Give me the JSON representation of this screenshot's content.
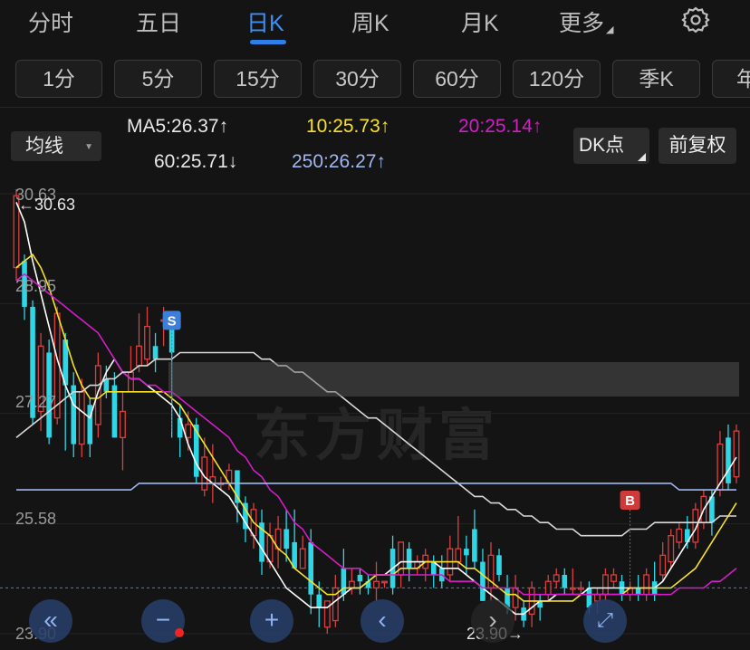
{
  "period_tabs": [
    {
      "label": "分时",
      "active": false
    },
    {
      "label": "五日",
      "active": false
    },
    {
      "label": "日K",
      "active": true
    },
    {
      "label": "周K",
      "active": false
    },
    {
      "label": "月K",
      "active": false
    },
    {
      "label": "更多",
      "active": false
    }
  ],
  "interval_buttons": [
    "1分",
    "5分",
    "15分",
    "30分",
    "60分",
    "120分",
    "季K",
    "年"
  ],
  "indicator": {
    "select_label": "均线",
    "ma5": "MA5:26.37↑",
    "ma10": "10:25.73↑",
    "ma20": "20:25.14↑",
    "ma60": "60:25.71↓",
    "ma250": "250:26.27↑",
    "dk_label": "DK点",
    "adjust_label": "前复权"
  },
  "chart_data": {
    "type": "candlestick",
    "y_axis_labels": [
      "30.63",
      "28.95",
      "27.27",
      "25.58",
      "23.90"
    ],
    "ylim": [
      23.9,
      30.63
    ],
    "high_marker": "←30.63",
    "low_marker": "23.90→",
    "signals": [
      {
        "label": "S",
        "color": "#3b7fd9"
      },
      {
        "label": "B",
        "color": "#d03a3a"
      }
    ],
    "watermark": "东方财富",
    "candles": [
      [
        29.5,
        30.6,
        30.7,
        29.3
      ],
      [
        29.6,
        28.9,
        29.7,
        28.7
      ],
      [
        28.9,
        27.2,
        29.0,
        27.1
      ],
      [
        27.3,
        28.3,
        28.5,
        27.0
      ],
      [
        28.2,
        26.9,
        28.4,
        26.8
      ],
      [
        27.2,
        28.8,
        28.9,
        27.1
      ],
      [
        28.4,
        27.7,
        28.5,
        26.7
      ],
      [
        27.7,
        26.8,
        27.9,
        26.6
      ],
      [
        26.8,
        27.6,
        27.8,
        26.6
      ],
      [
        27.4,
        26.8,
        27.5,
        26.6
      ],
      [
        27.1,
        28.0,
        28.2,
        26.9
      ],
      [
        27.8,
        27.6,
        28.0,
        27.5
      ],
      [
        27.7,
        26.9,
        27.9,
        26.9
      ],
      [
        26.9,
        27.3,
        27.6,
        26.4
      ],
      [
        27.6,
        27.9,
        28.3,
        27.6
      ],
      [
        28.0,
        28.3,
        28.8,
        27.9
      ],
      [
        28.1,
        28.6,
        28.9,
        28.0
      ],
      [
        28.3,
        28.1,
        28.5,
        27.9
      ],
      [
        28.7,
        28.7,
        28.9,
        28.3
      ],
      [
        28.6,
        28.2,
        28.8,
        26.9
      ],
      [
        27.2,
        26.9,
        27.4,
        26.6
      ],
      [
        26.9,
        27.1,
        27.3,
        26.7
      ],
      [
        27.1,
        26.3,
        27.2,
        26.2
      ],
      [
        26.1,
        26.6,
        26.9,
        26.0
      ],
      [
        26.2,
        26.3,
        26.8,
        25.9
      ],
      [
        26.2,
        26.2,
        26.3,
        26.1
      ],
      [
        26.2,
        26.4,
        26.5,
        26.1
      ],
      [
        26.4,
        25.9,
        26.4,
        25.6
      ],
      [
        25.9,
        25.5,
        26.0,
        25.3
      ],
      [
        25.4,
        25.8,
        25.9,
        25.2
      ],
      [
        25.6,
        25.0,
        25.8,
        24.8
      ],
      [
        25.0,
        25.4,
        25.6,
        24.9
      ],
      [
        25.2,
        25.5,
        25.7,
        24.9
      ],
      [
        25.5,
        25.2,
        25.8,
        25.0
      ],
      [
        25.3,
        24.9,
        25.8,
        24.9
      ],
      [
        24.9,
        25.2,
        25.4,
        24.9
      ],
      [
        25.3,
        24.5,
        25.5,
        24.2
      ],
      [
        24.5,
        24.3,
        24.7,
        24.0
      ],
      [
        24.0,
        24.4,
        24.4,
        23.9
      ],
      [
        24.1,
        24.6,
        24.8,
        24.0
      ],
      [
        24.9,
        24.5,
        25.2,
        24.4
      ],
      [
        24.6,
        24.7,
        24.9,
        24.5
      ],
      [
        24.8,
        24.7,
        24.9,
        24.5
      ],
      [
        24.7,
        24.6,
        24.8,
        24.5
      ],
      [
        24.6,
        24.7,
        25.0,
        24.4
      ],
      [
        24.7,
        24.7,
        24.7,
        24.6
      ],
      [
        25.2,
        24.6,
        25.4,
        24.5
      ],
      [
        24.8,
        25.3,
        25.3,
        24.6
      ],
      [
        25.2,
        24.9,
        25.3,
        24.7
      ],
      [
        24.9,
        25.0,
        25.1,
        24.8
      ],
      [
        24.9,
        25.1,
        25.2,
        24.7
      ],
      [
        25.0,
        24.8,
        25.1,
        24.6
      ],
      [
        24.9,
        24.7,
        25.1,
        24.6
      ],
      [
        24.8,
        25.2,
        25.4,
        24.7
      ],
      [
        25.0,
        25.2,
        25.7,
        24.9
      ],
      [
        25.2,
        25.1,
        25.4,
        24.8
      ],
      [
        25.5,
        25.0,
        25.8,
        24.9
      ],
      [
        25.0,
        24.4,
        25.2,
        24.4
      ],
      [
        24.6,
        25.1,
        25.3,
        24.4
      ],
      [
        25.1,
        24.8,
        25.2,
        24.7
      ],
      [
        24.6,
        24.3,
        24.8,
        24.2
      ],
      [
        24.3,
        24.6,
        24.8,
        24.1
      ],
      [
        24.3,
        24.1,
        24.4,
        24.0
      ],
      [
        24.2,
        24.6,
        24.7,
        24.0
      ],
      [
        24.4,
        24.3,
        24.5,
        24.1
      ],
      [
        24.5,
        24.7,
        24.8,
        24.4
      ],
      [
        24.7,
        24.8,
        24.9,
        24.6
      ],
      [
        24.8,
        24.6,
        24.9,
        24.5
      ],
      [
        24.6,
        24.6,
        24.9,
        24.5
      ],
      [
        24.6,
        24.6,
        24.7,
        24.5
      ],
      [
        24.6,
        24.3,
        24.7,
        24.2
      ],
      [
        24.4,
        24.5,
        24.6,
        24.2
      ],
      [
        24.5,
        24.8,
        24.9,
        24.4
      ],
      [
        24.7,
        24.8,
        24.9,
        24.6
      ],
      [
        24.7,
        24.5,
        24.8,
        24.4
      ],
      [
        24.5,
        24.6,
        24.7,
        24.4
      ],
      [
        24.6,
        24.5,
        24.8,
        24.4
      ],
      [
        24.5,
        24.8,
        24.9,
        24.4
      ],
      [
        24.7,
        24.5,
        25.0,
        24.4
      ],
      [
        24.8,
        25.1,
        25.3,
        24.7
      ],
      [
        25.0,
        25.4,
        25.5,
        24.9
      ],
      [
        25.3,
        25.5,
        25.6,
        25.2
      ],
      [
        25.5,
        25.3,
        25.7,
        25.2
      ],
      [
        25.3,
        25.8,
        25.9,
        25.2
      ],
      [
        25.6,
        26.0,
        26.1,
        25.5
      ],
      [
        26.0,
        25.6,
        26.1,
        25.4
      ],
      [
        26.1,
        26.8,
        27.0,
        26.0
      ],
      [
        26.9,
        26.2,
        27.1,
        26.1
      ],
      [
        26.3,
        27.0,
        27.1,
        26.2
      ]
    ],
    "ma_series": [
      {
        "name": "MA5",
        "color": "#ffffff",
        "values": [
          30.5,
          30.2,
          29.6,
          29.1,
          28.6,
          28.1,
          27.7,
          27.4,
          27.3,
          27.2,
          27.6,
          27.9,
          28.1,
          27.9,
          27.8,
          27.8,
          27.7,
          27.6,
          27.5,
          27.4,
          27.2,
          26.8,
          26.5,
          26.3,
          26.2,
          26.1,
          26.0,
          25.8,
          25.6,
          25.4,
          25.2,
          25.0,
          24.8,
          24.6,
          24.5,
          24.4,
          24.3,
          24.3,
          24.3,
          24.4,
          24.5,
          24.6,
          24.6,
          24.7,
          24.8,
          24.8,
          24.9,
          25.0,
          25.0,
          25.0,
          25.0,
          25.0,
          24.9,
          24.9,
          24.9,
          24.8,
          24.7,
          24.6,
          24.5,
          24.4,
          24.3,
          24.2,
          24.2,
          24.3,
          24.4,
          24.4,
          24.5,
          24.5,
          24.5,
          24.5,
          24.6,
          24.6,
          24.6,
          24.6,
          24.6,
          24.6,
          24.6,
          24.6,
          24.6,
          24.7,
          24.9,
          25.1,
          25.3,
          25.5,
          25.8,
          26.0,
          26.2,
          26.4,
          26.6
        ]
      },
      {
        "name": "MA10",
        "color": "#f7e12b",
        "values": [
          29.5,
          29.6,
          29.7,
          29.5,
          29.2,
          28.8,
          28.4,
          28.0,
          27.7,
          27.5,
          27.5,
          27.6,
          27.6,
          27.6,
          27.6,
          27.6,
          27.6,
          27.6,
          27.6,
          27.5,
          27.4,
          27.2,
          27.0,
          26.8,
          26.6,
          26.4,
          26.2,
          26.0,
          25.8,
          25.6,
          25.5,
          25.4,
          25.2,
          25.1,
          24.9,
          24.8,
          24.7,
          24.6,
          24.5,
          24.5,
          24.6,
          24.6,
          24.6,
          24.7,
          24.8,
          24.8,
          24.8,
          24.9,
          24.9,
          24.9,
          25.0,
          25.0,
          25.0,
          25.0,
          25.0,
          24.9,
          24.9,
          24.8,
          24.7,
          24.6,
          24.5,
          24.5,
          24.4,
          24.4,
          24.4,
          24.4,
          24.4,
          24.4,
          24.4,
          24.5,
          24.5,
          24.5,
          24.5,
          24.5,
          24.5,
          24.6,
          24.6,
          24.6,
          24.6,
          24.6,
          24.6,
          24.7,
          24.8,
          24.9,
          25.1,
          25.3,
          25.5,
          25.7,
          25.9
        ]
      },
      {
        "name": "MA20",
        "color": "#d21ec8",
        "values": [
          29.3,
          29.4,
          29.3,
          29.2,
          29.1,
          29.0,
          28.9,
          28.8,
          28.7,
          28.6,
          28.5,
          28.3,
          28.1,
          27.9,
          27.8,
          27.8,
          27.7,
          27.7,
          27.6,
          27.6,
          27.5,
          27.4,
          27.3,
          27.2,
          27.1,
          27.0,
          26.9,
          26.7,
          26.6,
          26.4,
          26.3,
          26.1,
          26.0,
          25.8,
          25.6,
          25.5,
          25.3,
          25.2,
          25.1,
          25.0,
          24.9,
          24.9,
          24.9,
          24.8,
          24.8,
          24.8,
          24.8,
          24.8,
          24.8,
          24.8,
          24.8,
          24.8,
          24.8,
          24.7,
          24.7,
          24.7,
          24.7,
          24.6,
          24.6,
          24.6,
          24.6,
          24.6,
          24.5,
          24.5,
          24.5,
          24.5,
          24.5,
          24.5,
          24.5,
          24.5,
          24.5,
          24.5,
          24.5,
          24.5,
          24.5,
          24.5,
          24.5,
          24.5,
          24.5,
          24.5,
          24.5,
          24.6,
          24.6,
          24.6,
          24.6,
          24.7,
          24.7,
          24.8,
          24.9
        ]
      },
      {
        "name": "MA60",
        "color": "#d8d8d8",
        "values": [
          26.9,
          27.0,
          27.1,
          27.2,
          27.3,
          27.4,
          27.5,
          27.6,
          27.6,
          27.7,
          27.7,
          27.8,
          27.8,
          27.9,
          27.9,
          28.0,
          28.0,
          28.1,
          28.1,
          28.1,
          28.2,
          28.2,
          28.2,
          28.2,
          28.2,
          28.2,
          28.2,
          28.2,
          28.2,
          28.2,
          28.1,
          28.1,
          28.0,
          28.0,
          27.9,
          27.9,
          27.8,
          27.7,
          27.6,
          27.6,
          27.5,
          27.4,
          27.3,
          27.2,
          27.2,
          27.1,
          27.0,
          26.9,
          26.8,
          26.7,
          26.6,
          26.5,
          26.4,
          26.3,
          26.2,
          26.1,
          26.0,
          26.0,
          25.9,
          25.9,
          25.8,
          25.8,
          25.7,
          25.7,
          25.6,
          25.6,
          25.5,
          25.5,
          25.5,
          25.4,
          25.4,
          25.4,
          25.4,
          25.4,
          25.4,
          25.5,
          25.5,
          25.5,
          25.6,
          25.6,
          25.6,
          25.6,
          25.6,
          25.6,
          25.6,
          25.6,
          25.7,
          25.7,
          25.7
        ]
      },
      {
        "name": "MA250",
        "color": "#9fb7f2",
        "values": [
          26.1,
          26.1,
          26.1,
          26.1,
          26.1,
          26.1,
          26.1,
          26.1,
          26.1,
          26.1,
          26.1,
          26.1,
          26.1,
          26.1,
          26.1,
          26.2,
          26.2,
          26.2,
          26.2,
          26.2,
          26.2,
          26.2,
          26.2,
          26.2,
          26.2,
          26.2,
          26.2,
          26.2,
          26.2,
          26.2,
          26.2,
          26.2,
          26.2,
          26.2,
          26.2,
          26.2,
          26.2,
          26.2,
          26.2,
          26.2,
          26.2,
          26.2,
          26.2,
          26.2,
          26.2,
          26.2,
          26.2,
          26.2,
          26.2,
          26.2,
          26.2,
          26.2,
          26.2,
          26.2,
          26.2,
          26.2,
          26.2,
          26.2,
          26.2,
          26.2,
          26.2,
          26.2,
          26.2,
          26.2,
          26.2,
          26.2,
          26.2,
          26.2,
          26.2,
          26.2,
          26.2,
          26.2,
          26.2,
          26.2,
          26.2,
          26.2,
          26.2,
          26.2,
          26.2,
          26.2,
          26.2,
          26.1,
          26.1,
          26.1,
          26.1,
          26.1,
          26.1,
          26.1,
          26.1
        ]
      }
    ],
    "dashed_price_level": 24.6
  },
  "colors": {
    "up": "#d94040",
    "down": "#2ed6e6",
    "accent": "#3d8ff5",
    "background": "#141414"
  },
  "icons": [
    "settings-gear-icon",
    "double-left-icon",
    "zoom-out-icon",
    "zoom-in-icon",
    "left-arrow-icon",
    "right-arrow-icon",
    "fullscreen-icon"
  ]
}
